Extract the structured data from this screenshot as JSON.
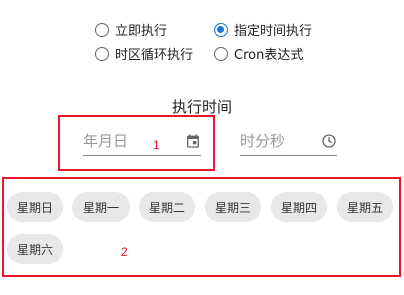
{
  "execution_mode": {
    "options": [
      {
        "label": "立即执行",
        "checked": false
      },
      {
        "label": "指定时间执行",
        "checked": true
      },
      {
        "label": "时区循环执行",
        "checked": false
      },
      {
        "label": "Cron表达式",
        "checked": false
      }
    ]
  },
  "execution_time": {
    "title": "执行时间",
    "date_placeholder": "年月日",
    "time_placeholder": "时分秒",
    "date_icon": "calendar-icon",
    "time_icon": "clock-icon"
  },
  "weekdays": [
    "星期日",
    "星期一",
    "星期二",
    "星期三",
    "星期四",
    "星期五",
    "星期六"
  ],
  "annotations": {
    "box1": "1",
    "box2": "2"
  },
  "colors": {
    "accent": "#1976d2",
    "annotation": "#e8152b",
    "chip_bg": "#e8e8e8"
  }
}
